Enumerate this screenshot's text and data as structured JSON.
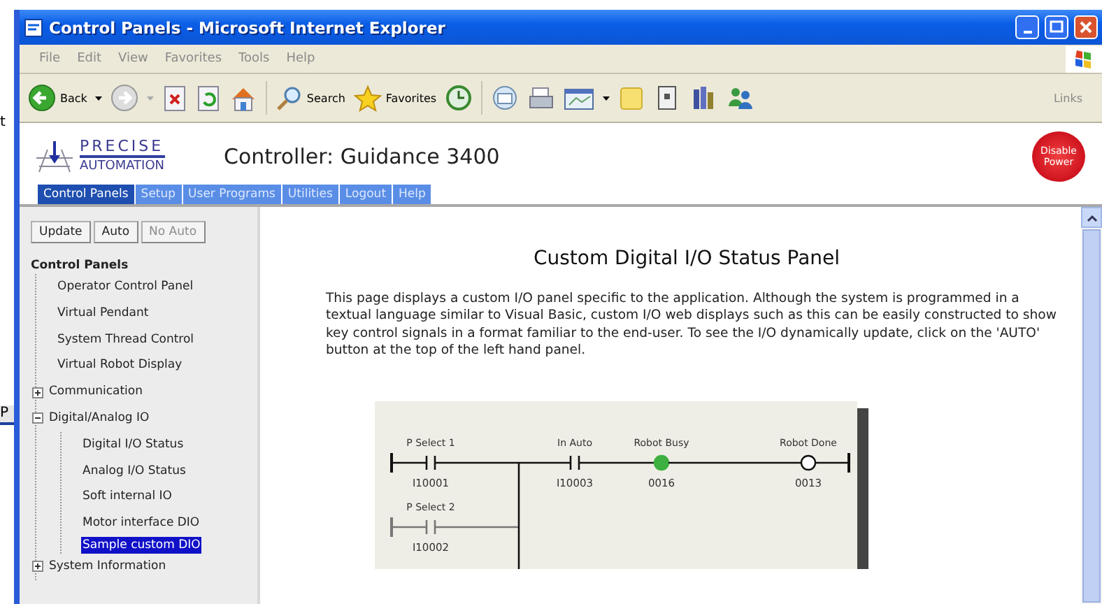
{
  "background_fragments": [
    "t",
    "P"
  ],
  "window": {
    "title": "Control Panels - Microsoft Internet Explorer"
  },
  "menu": [
    "File",
    "Edit",
    "View",
    "Favorites",
    "Tools",
    "Help"
  ],
  "toolbar": {
    "back": "Back",
    "search": "Search",
    "favorites": "Favorites",
    "links": "Links"
  },
  "header": {
    "logo_top": "PRECISE",
    "logo_bottom": "AUTOMATION",
    "title": "Controller: Guidance 3400",
    "power_button": "Disable Power"
  },
  "tabs": [
    {
      "label": "Control Panels",
      "selected": true
    },
    {
      "label": "Setup",
      "selected": false
    },
    {
      "label": "User Programs",
      "selected": false
    },
    {
      "label": "Utilities",
      "selected": false
    },
    {
      "label": "Logout",
      "selected": false
    },
    {
      "label": "Help",
      "selected": false
    }
  ],
  "sidebar": {
    "buttons": [
      {
        "label": "Update",
        "disabled": false
      },
      {
        "label": "Auto",
        "disabled": false
      },
      {
        "label": "No Auto",
        "disabled": true
      }
    ],
    "tree": {
      "label": "Control Panels",
      "children": [
        {
          "label": "Operator Control Panel",
          "selected": false
        },
        {
          "label": "Virtual Pendant",
          "selected": false
        },
        {
          "label": "System Thread Control",
          "selected": false
        },
        {
          "label": "Virtual Robot Display",
          "selected": false
        },
        {
          "label": "Communication",
          "selected": false,
          "expanded": false
        },
        {
          "label": "Digital/Analog IO",
          "selected": false,
          "expanded": true,
          "children": [
            {
              "label": "Digital I/O Status",
              "selected": false
            },
            {
              "label": "Analog I/O Status",
              "selected": false
            },
            {
              "label": "Soft internal IO",
              "selected": false
            },
            {
              "label": "Motor interface DIO",
              "selected": false
            },
            {
              "label": "Sample custom DIO",
              "selected": true
            }
          ]
        },
        {
          "label": "System Information",
          "selected": false,
          "expanded": false
        }
      ]
    }
  },
  "content": {
    "heading": "Custom Digital I/O Status Panel",
    "paragraph": "This page displays a custom I/O panel specific to the application. Although the system is programmed in a textual language similar to Visual Basic, custom I/O web displays such as this can be easily constructed to show key control signals in a format familiar to the end-user.  To see the I/O dynamically update, click on the 'AUTO' button at the top of the left hand panel.",
    "ladder": {
      "rungs": [
        {
          "energized": true,
          "elements": [
            {
              "kind": "contact",
              "label": "P Select 1",
              "address": "I10001"
            },
            {
              "kind": "contact",
              "label": "In Auto",
              "address": "I10003"
            },
            {
              "kind": "coil",
              "label": "Robot Busy",
              "address": "0016",
              "on": true
            },
            {
              "kind": "coil",
              "label": "Robot Done",
              "address": "0013",
              "on": false
            }
          ]
        },
        {
          "energized": false,
          "elements": [
            {
              "kind": "contact",
              "label": "P Select 2",
              "address": "I10002"
            }
          ]
        }
      ]
    }
  }
}
